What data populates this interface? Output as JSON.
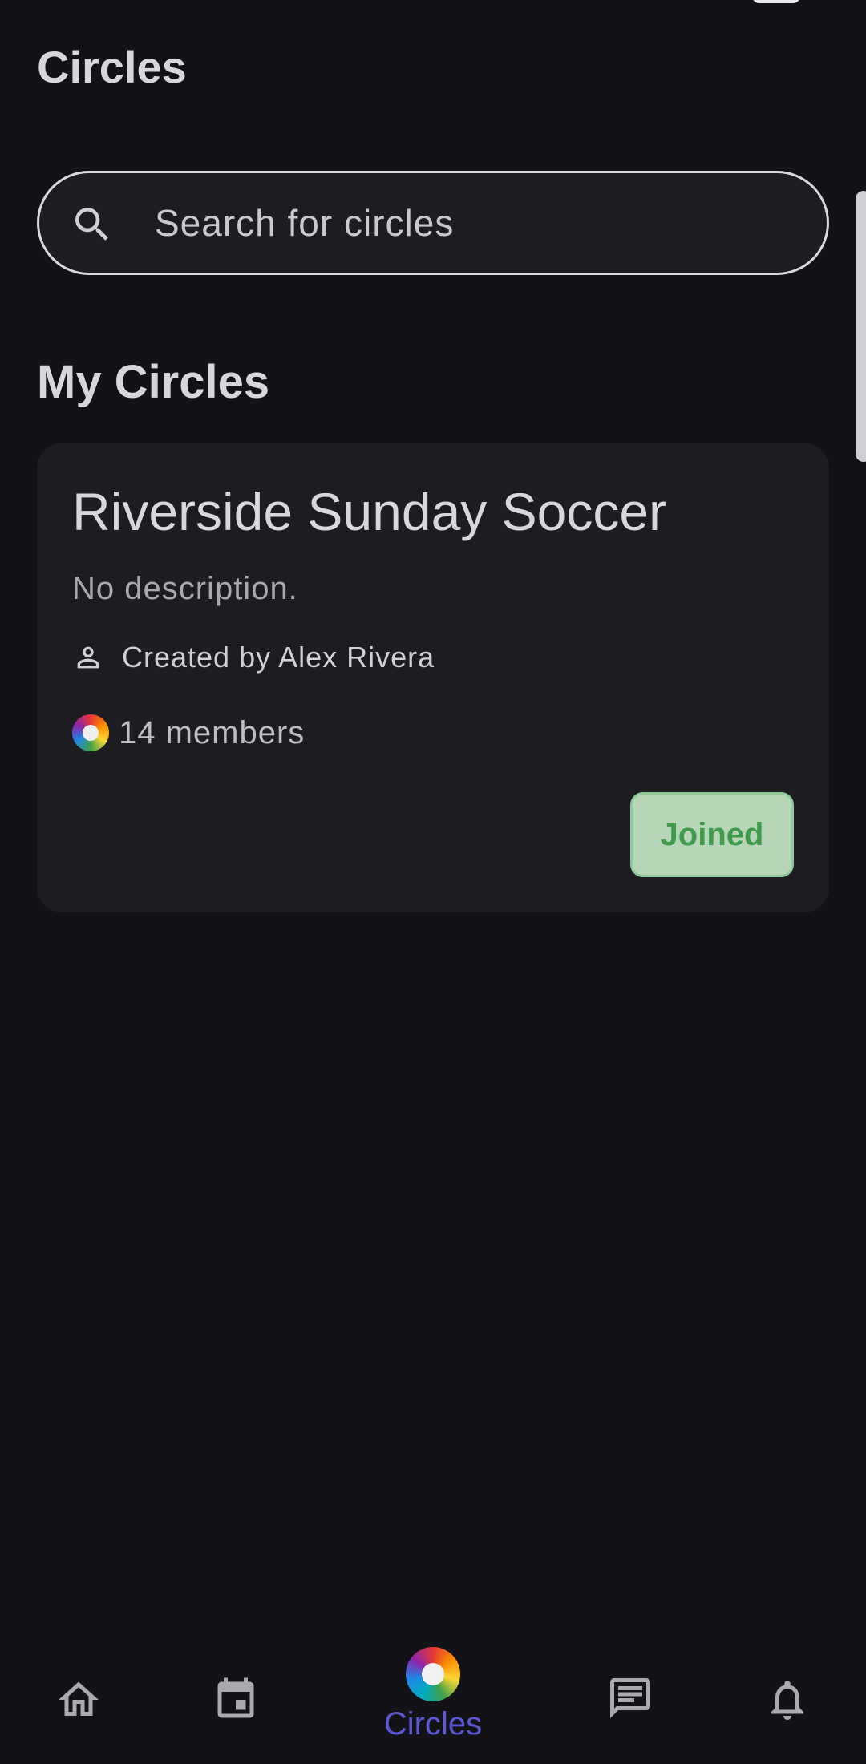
{
  "header": {
    "title": "Circles"
  },
  "search": {
    "placeholder": "Search for circles",
    "value": ""
  },
  "my_circles": {
    "section_title": "My Circles",
    "items": [
      {
        "name": "Riverside Sunday Soccer",
        "description": "No description.",
        "creator": "Created by Alex Rivera",
        "members": "14 members",
        "status_label": "Joined"
      }
    ]
  },
  "bottom_nav": {
    "items": [
      {
        "icon": "home-icon",
        "label": ""
      },
      {
        "icon": "calendar-icon",
        "label": ""
      },
      {
        "icon": "circles-logo-icon",
        "label": "Circles"
      },
      {
        "icon": "message-icon",
        "label": ""
      },
      {
        "icon": "bell-icon",
        "label": ""
      }
    ],
    "active_color": "#5b57d1"
  },
  "colors": {
    "background": "#121217",
    "card": "#1c1c21",
    "joined_bg": "#b6d6b7",
    "joined_text": "#3f9a4c"
  }
}
